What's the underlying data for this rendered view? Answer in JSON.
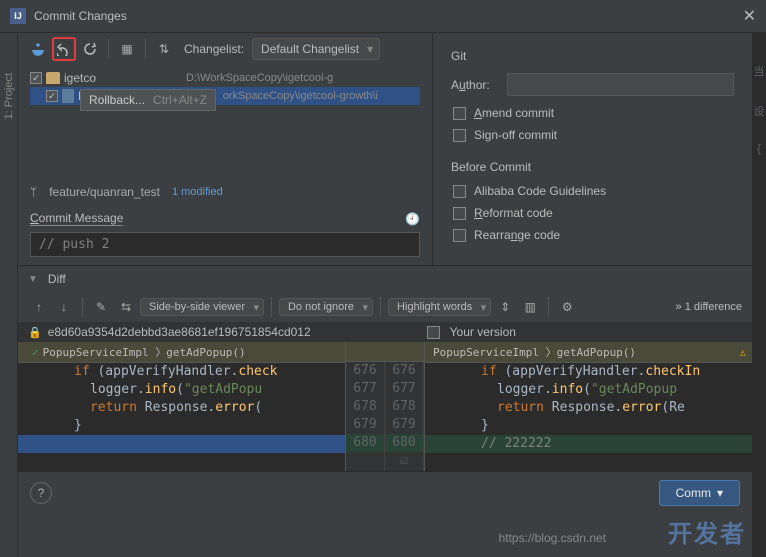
{
  "titlebar": {
    "title": "Commit Changes"
  },
  "toolbar": {
    "changelist_label": "Changelist:",
    "changelist_value": "Default Changelist"
  },
  "tooltip": {
    "text": "Rollback...",
    "shortcut": "Ctrl+Alt+Z"
  },
  "tree": {
    "root_name": "igetco",
    "root_path": "D:\\WorkSpaceCopy\\igetcool-g",
    "file_name": "Po",
    "file_path": "orkSpaceCopy\\igetcool-growth\\i"
  },
  "branch": {
    "name": "feature/quanran_test",
    "modified": "1 modified"
  },
  "commit_msg": {
    "label": "Commit Message",
    "value": "// push 2"
  },
  "git": {
    "section": "Git",
    "author_label": "Author:",
    "author_value": "",
    "amend": "Amend commit",
    "signoff": "Sign-off commit"
  },
  "before_commit": {
    "section": "Before Commit",
    "alibaba": "Alibaba Code Guidelines",
    "reformat": "Reformat code",
    "rearrange": "Rearrange code"
  },
  "diff": {
    "label": "Diff",
    "viewer": "Side-by-side viewer",
    "whitespace": "Do not ignore",
    "highlight": "Highlight words",
    "count": "1 difference",
    "hash": "e8d60a9354d2debbd3ae8681ef196751854cd012",
    "version_label": "Your version",
    "breadcrumb_left": "PopupServiceImpl 〉getAdPopup()",
    "breadcrumb_right": "PopupServiceImpl 〉getAdPopup()"
  },
  "code": {
    "left": [
      {
        "indent": 3,
        "tokens": [
          {
            "t": "if ",
            "c": "kw"
          },
          {
            "t": "(appVerifyHandler",
            "c": "ident"
          },
          {
            "t": ".",
            "c": ""
          },
          {
            "t": "check",
            "c": "method"
          }
        ]
      },
      {
        "indent": 4,
        "tokens": [
          {
            "t": "logger",
            "c": "ident"
          },
          {
            "t": ".",
            "c": ""
          },
          {
            "t": "info",
            "c": "method"
          },
          {
            "t": "(",
            "c": ""
          },
          {
            "t": "\"getAdPopu",
            "c": "str"
          }
        ]
      },
      {
        "indent": 4,
        "tokens": [
          {
            "t": "return ",
            "c": "kw"
          },
          {
            "t": "Response",
            "c": "ident"
          },
          {
            "t": ".",
            "c": ""
          },
          {
            "t": "error",
            "c": "method"
          },
          {
            "t": "(",
            "c": ""
          }
        ]
      },
      {
        "indent": 3,
        "tokens": [
          {
            "t": "}",
            "c": ""
          }
        ]
      },
      {
        "indent": 0,
        "tokens": [],
        "cls": "selected-change"
      },
      {
        "indent": 3,
        "tokens": [
          {
            "t": "",
            "c": ""
          }
        ]
      }
    ],
    "right": [
      {
        "indent": 3,
        "tokens": [
          {
            "t": "if ",
            "c": "kw"
          },
          {
            "t": "(appVerifyHandler",
            "c": "ident"
          },
          {
            "t": ".",
            "c": ""
          },
          {
            "t": "checkIn",
            "c": "method"
          }
        ]
      },
      {
        "indent": 4,
        "tokens": [
          {
            "t": "logger",
            "c": "ident"
          },
          {
            "t": ".",
            "c": ""
          },
          {
            "t": "info",
            "c": "method"
          },
          {
            "t": "(",
            "c": ""
          },
          {
            "t": "\"getAdPopup",
            "c": "str"
          }
        ]
      },
      {
        "indent": 4,
        "tokens": [
          {
            "t": "return ",
            "c": "kw"
          },
          {
            "t": "Response",
            "c": "ident"
          },
          {
            "t": ".",
            "c": ""
          },
          {
            "t": "error",
            "c": "method"
          },
          {
            "t": "(Re",
            "c": ""
          }
        ]
      },
      {
        "indent": 3,
        "tokens": [
          {
            "t": "}",
            "c": ""
          }
        ]
      },
      {
        "indent": 3,
        "tokens": [
          {
            "t": "// 222222",
            "c": "comm"
          }
        ],
        "cls": "added"
      },
      {
        "indent": 3,
        "tokens": [
          {
            "t": "",
            "c": ""
          }
        ]
      }
    ],
    "gutter": [
      {
        "l": "676",
        "r": "676"
      },
      {
        "l": "677",
        "r": "677"
      },
      {
        "l": "678",
        "r": "678"
      },
      {
        "l": "679",
        "r": "679"
      },
      {
        "l": "680",
        "r": "680",
        "chk": true
      },
      {
        "l": "",
        "r": ""
      }
    ]
  },
  "bottom": {
    "commit": "Comm"
  },
  "watermark": {
    "text": "开发者",
    "url": "https://blog.csdn.net"
  },
  "sidebar": {
    "project": "1: Project"
  }
}
